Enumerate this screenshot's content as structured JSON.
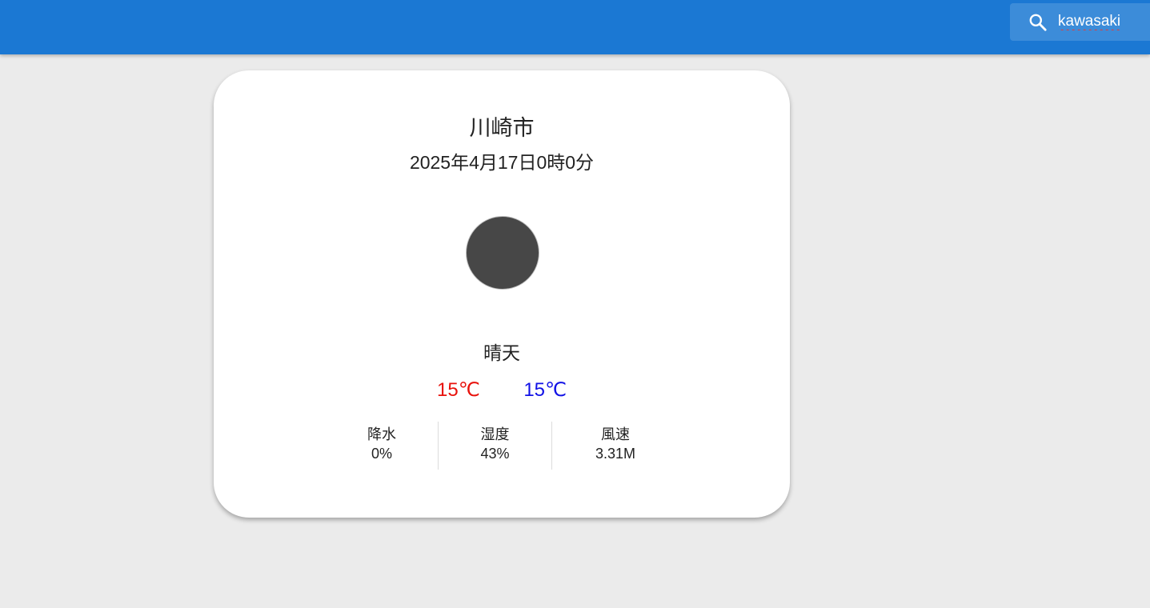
{
  "search": {
    "value": "kawasaki",
    "icon": "search-icon"
  },
  "colors": {
    "appbar": "#1b78d3",
    "background": "#ebebeb",
    "temp_max": "#e8120c",
    "temp_min": "#1212e6",
    "weather_icon": "#474747"
  },
  "weather": {
    "city": "川崎市",
    "datetime": "2025年4月17日0時0分",
    "icon": "weather-circle-icon",
    "condition": "晴天",
    "temp_max": "15℃",
    "temp_min": "15℃",
    "stats": [
      {
        "label": "降水",
        "value": "0%"
      },
      {
        "label": "湿度",
        "value": "43%"
      },
      {
        "label": "風速",
        "value": "3.31M"
      }
    ]
  }
}
